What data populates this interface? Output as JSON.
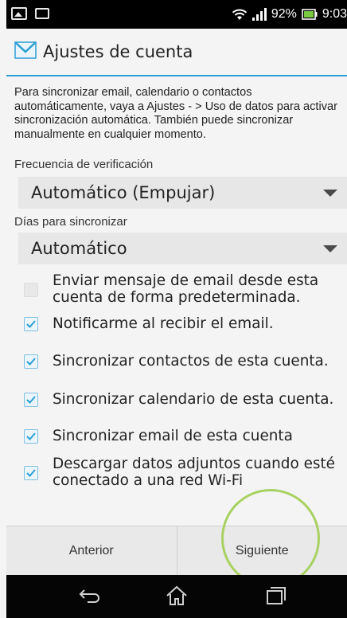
{
  "status_bar": {
    "battery_percent": "92%",
    "time": "9:03",
    "icons": [
      "picture-icon",
      "sd-card-icon",
      "wifi-icon",
      "signal-icon",
      "battery-icon"
    ]
  },
  "header": {
    "icon": "mail-icon",
    "title": "Ajustes de cuenta"
  },
  "info_text": "Para sincronizar email, calendario o contactos automáticamente, vaya a Ajustes - > Uso de datos para activar sincronización automática. También puede sincronizar manualmente en cualquier momento.",
  "frequency": {
    "label": "Frecuencia de verificación",
    "value": "Automático (Empujar)"
  },
  "sync_days": {
    "label": "Días para sincronizar",
    "value": "Automático"
  },
  "options": [
    {
      "label": "Enviar mensaje de email desde esta cuenta de forma predeterminada.",
      "checked": false
    },
    {
      "label": "Notificarme al recibir el email.",
      "checked": true
    },
    {
      "label": "Sincronizar contactos de esta cuenta.",
      "checked": true
    },
    {
      "label": "Sincronizar calendario de esta cuenta.",
      "checked": true
    },
    {
      "label": "Sincronizar email de esta cuenta",
      "checked": true
    },
    {
      "label": "Descargar datos adjuntos cuando esté conectado a una red Wi-Fi",
      "checked": true
    }
  ],
  "buttons": {
    "previous": "Anterior",
    "next": "Siguiente"
  },
  "nav": [
    "back-icon",
    "home-icon",
    "recent-apps-icon"
  ],
  "colors": {
    "accent": "#2c9fd4",
    "highlight_ring": "#a9d161",
    "check": "#2c9fd4"
  }
}
